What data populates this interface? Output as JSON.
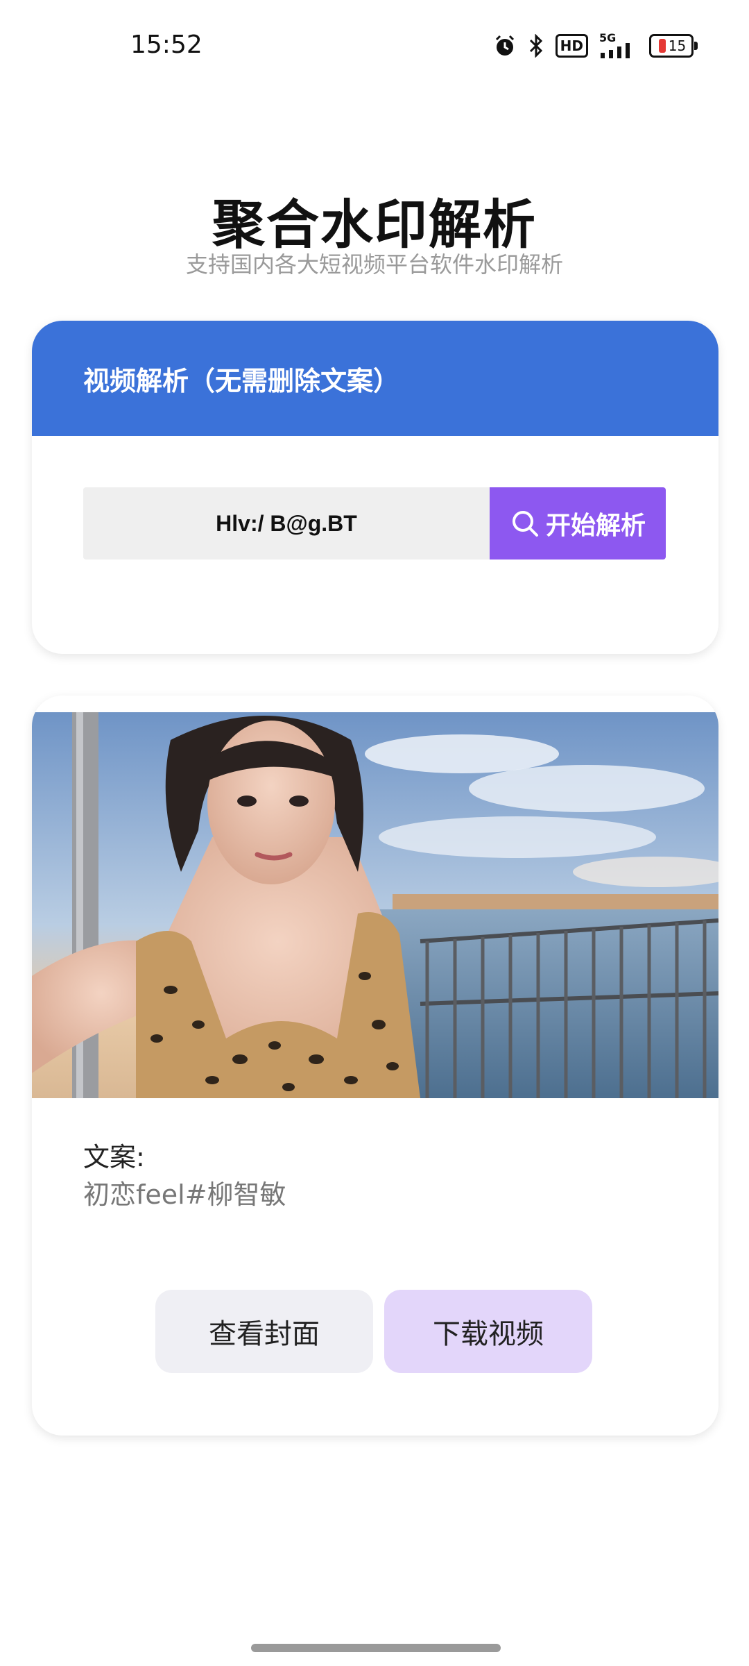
{
  "status_bar": {
    "time": "15:52",
    "network": "5G",
    "hd": "HD",
    "battery": "15",
    "icons": [
      "alarm-icon",
      "bluetooth-icon",
      "hd-icon",
      "signal-icon",
      "battery-icon"
    ]
  },
  "header": {
    "title": "聚合水印解析",
    "subtitle": "支持国内各大短视频平台软件水印解析"
  },
  "parse_card": {
    "title": "视频解析（无需删除文案）",
    "input_value": "Hlv:/ B@g.BT",
    "button_label": "开始解析",
    "accent": "#3b72d9",
    "button_color": "#8d58f0"
  },
  "result_card": {
    "caption_label": "文案:",
    "caption_text": "初恋feel#柳智敏",
    "buttons": {
      "view_cover": "查看封面",
      "download_video": "下载视频"
    }
  }
}
